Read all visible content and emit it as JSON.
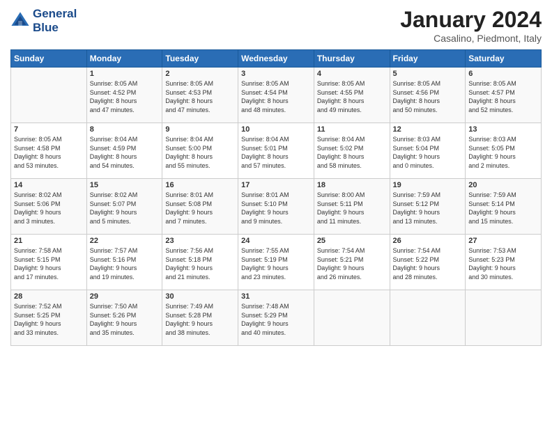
{
  "header": {
    "logo_line1": "General",
    "logo_line2": "Blue",
    "month_title": "January 2024",
    "location": "Casalino, Piedmont, Italy"
  },
  "days_of_week": [
    "Sunday",
    "Monday",
    "Tuesday",
    "Wednesday",
    "Thursday",
    "Friday",
    "Saturday"
  ],
  "weeks": [
    [
      {
        "day": "",
        "info": ""
      },
      {
        "day": "1",
        "info": "Sunrise: 8:05 AM\nSunset: 4:52 PM\nDaylight: 8 hours\nand 47 minutes."
      },
      {
        "day": "2",
        "info": "Sunrise: 8:05 AM\nSunset: 4:53 PM\nDaylight: 8 hours\nand 47 minutes."
      },
      {
        "day": "3",
        "info": "Sunrise: 8:05 AM\nSunset: 4:54 PM\nDaylight: 8 hours\nand 48 minutes."
      },
      {
        "day": "4",
        "info": "Sunrise: 8:05 AM\nSunset: 4:55 PM\nDaylight: 8 hours\nand 49 minutes."
      },
      {
        "day": "5",
        "info": "Sunrise: 8:05 AM\nSunset: 4:56 PM\nDaylight: 8 hours\nand 50 minutes."
      },
      {
        "day": "6",
        "info": "Sunrise: 8:05 AM\nSunset: 4:57 PM\nDaylight: 8 hours\nand 52 minutes."
      }
    ],
    [
      {
        "day": "7",
        "info": "Sunrise: 8:05 AM\nSunset: 4:58 PM\nDaylight: 8 hours\nand 53 minutes."
      },
      {
        "day": "8",
        "info": "Sunrise: 8:04 AM\nSunset: 4:59 PM\nDaylight: 8 hours\nand 54 minutes."
      },
      {
        "day": "9",
        "info": "Sunrise: 8:04 AM\nSunset: 5:00 PM\nDaylight: 8 hours\nand 55 minutes."
      },
      {
        "day": "10",
        "info": "Sunrise: 8:04 AM\nSunset: 5:01 PM\nDaylight: 8 hours\nand 57 minutes."
      },
      {
        "day": "11",
        "info": "Sunrise: 8:04 AM\nSunset: 5:02 PM\nDaylight: 8 hours\nand 58 minutes."
      },
      {
        "day": "12",
        "info": "Sunrise: 8:03 AM\nSunset: 5:04 PM\nDaylight: 9 hours\nand 0 minutes."
      },
      {
        "day": "13",
        "info": "Sunrise: 8:03 AM\nSunset: 5:05 PM\nDaylight: 9 hours\nand 2 minutes."
      }
    ],
    [
      {
        "day": "14",
        "info": "Sunrise: 8:02 AM\nSunset: 5:06 PM\nDaylight: 9 hours\nand 3 minutes."
      },
      {
        "day": "15",
        "info": "Sunrise: 8:02 AM\nSunset: 5:07 PM\nDaylight: 9 hours\nand 5 minutes."
      },
      {
        "day": "16",
        "info": "Sunrise: 8:01 AM\nSunset: 5:08 PM\nDaylight: 9 hours\nand 7 minutes."
      },
      {
        "day": "17",
        "info": "Sunrise: 8:01 AM\nSunset: 5:10 PM\nDaylight: 9 hours\nand 9 minutes."
      },
      {
        "day": "18",
        "info": "Sunrise: 8:00 AM\nSunset: 5:11 PM\nDaylight: 9 hours\nand 11 minutes."
      },
      {
        "day": "19",
        "info": "Sunrise: 7:59 AM\nSunset: 5:12 PM\nDaylight: 9 hours\nand 13 minutes."
      },
      {
        "day": "20",
        "info": "Sunrise: 7:59 AM\nSunset: 5:14 PM\nDaylight: 9 hours\nand 15 minutes."
      }
    ],
    [
      {
        "day": "21",
        "info": "Sunrise: 7:58 AM\nSunset: 5:15 PM\nDaylight: 9 hours\nand 17 minutes."
      },
      {
        "day": "22",
        "info": "Sunrise: 7:57 AM\nSunset: 5:16 PM\nDaylight: 9 hours\nand 19 minutes."
      },
      {
        "day": "23",
        "info": "Sunrise: 7:56 AM\nSunset: 5:18 PM\nDaylight: 9 hours\nand 21 minutes."
      },
      {
        "day": "24",
        "info": "Sunrise: 7:55 AM\nSunset: 5:19 PM\nDaylight: 9 hours\nand 23 minutes."
      },
      {
        "day": "25",
        "info": "Sunrise: 7:54 AM\nSunset: 5:21 PM\nDaylight: 9 hours\nand 26 minutes."
      },
      {
        "day": "26",
        "info": "Sunrise: 7:54 AM\nSunset: 5:22 PM\nDaylight: 9 hours\nand 28 minutes."
      },
      {
        "day": "27",
        "info": "Sunrise: 7:53 AM\nSunset: 5:23 PM\nDaylight: 9 hours\nand 30 minutes."
      }
    ],
    [
      {
        "day": "28",
        "info": "Sunrise: 7:52 AM\nSunset: 5:25 PM\nDaylight: 9 hours\nand 33 minutes."
      },
      {
        "day": "29",
        "info": "Sunrise: 7:50 AM\nSunset: 5:26 PM\nDaylight: 9 hours\nand 35 minutes."
      },
      {
        "day": "30",
        "info": "Sunrise: 7:49 AM\nSunset: 5:28 PM\nDaylight: 9 hours\nand 38 minutes."
      },
      {
        "day": "31",
        "info": "Sunrise: 7:48 AM\nSunset: 5:29 PM\nDaylight: 9 hours\nand 40 minutes."
      },
      {
        "day": "",
        "info": ""
      },
      {
        "day": "",
        "info": ""
      },
      {
        "day": "",
        "info": ""
      }
    ]
  ]
}
